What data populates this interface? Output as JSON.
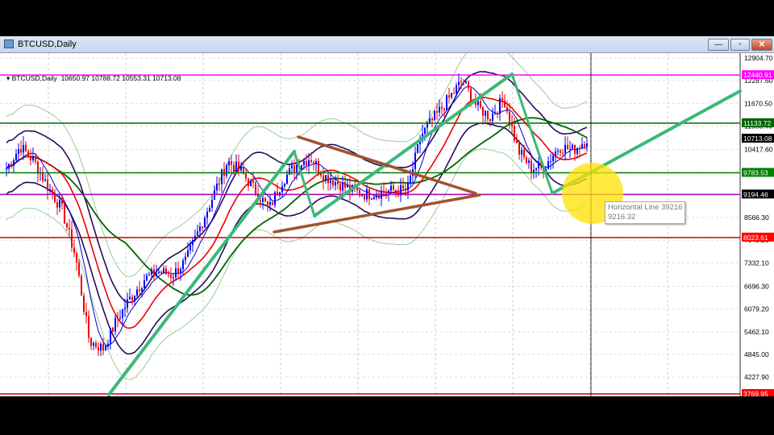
{
  "window": {
    "title": "BTCUSD,Daily",
    "minimize": "—",
    "maximize": "▫",
    "close": "✕"
  },
  "chart_header": {
    "symbol": "BTCUSD,Daily",
    "open": "10650.97",
    "high": "10788.72",
    "low": "10553.31",
    "close": "10713.08"
  },
  "price_axis": [
    "12904.70",
    "12287.60",
    "11670.50",
    "11053.40",
    "10417.60",
    "9800.50",
    "9183.40",
    "8566.30",
    "7949.20",
    "7332.10",
    "6696.30",
    "6079.20",
    "5462.10",
    "4845.00",
    "4227.90"
  ],
  "price_labels": [
    {
      "value": "12440.91",
      "color": "#ff00ff",
      "text": "#ffffff"
    },
    {
      "value": "11133.72",
      "color": "#006400",
      "text": "#ffffff"
    },
    {
      "value": "10713.08",
      "color": "#000000",
      "text": "#ffffff"
    },
    {
      "value": "9783.53",
      "color": "#008000",
      "text": "#ffffff"
    },
    {
      "value": "9194.46",
      "color": "#000000",
      "text": "#ffffff"
    },
    {
      "value": "8023.61",
      "color": "#ff0000",
      "text": "#ffffff"
    },
    {
      "value": "3769.95",
      "color": "#ff0000",
      "text": "#ffffff"
    }
  ],
  "tooltip": {
    "line1": "Horizontal Line 39216",
    "line2": "9216.32"
  },
  "chart_data": {
    "type": "candlestick",
    "title": "BTCUSD,Daily",
    "ylim": [
      3769.95,
      12904.7
    ],
    "close_path": [
      9900,
      10500,
      10100,
      9400,
      8800,
      7500,
      5200,
      5000,
      5800,
      6400,
      6900,
      7100,
      7000,
      7400,
      8300,
      9200,
      10100,
      9800,
      9300,
      8800,
      9600,
      10000,
      10200,
      9700,
      9500,
      9300,
      9200,
      9250,
      9300,
      9300,
      10800,
      11300,
      11800,
      12300,
      11600,
      11300,
      11800,
      10400,
      9900,
      10000,
      10500,
      10400,
      10713
    ],
    "horizontal_lines": [
      {
        "price": 12440.91,
        "color": "#ff00ff"
      },
      {
        "price": 11133.72,
        "color": "#006400"
      },
      {
        "price": 9783.53,
        "color": "#008000"
      },
      {
        "price": 9194.46,
        "color": "#aa00aa"
      },
      {
        "price": 8023.61,
        "color": "#cc0000"
      },
      {
        "price": 3769.95,
        "color": "#cc0000"
      }
    ]
  }
}
